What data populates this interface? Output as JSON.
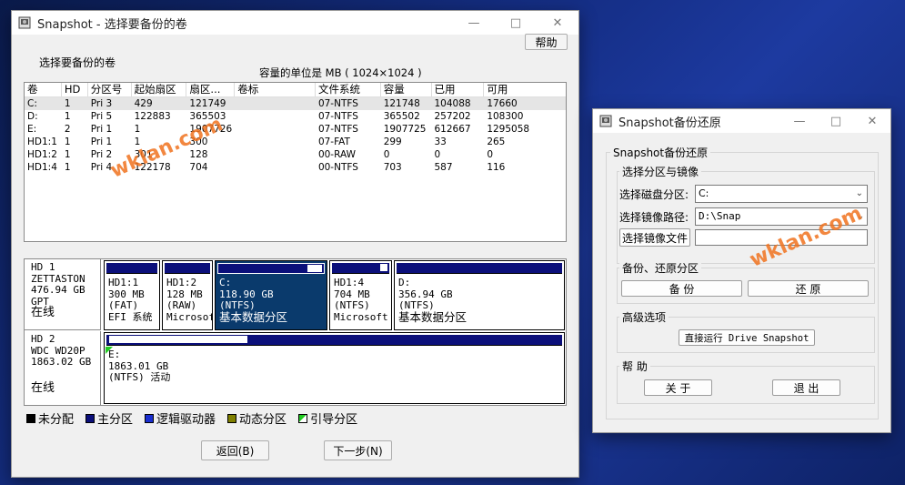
{
  "main_window": {
    "title": "Snapshot - 选择要备份的卷",
    "help_button": "帮助",
    "select_label": "选择要备份的卷",
    "unit_note": "容量的单位是 MB ( 1024×1024 )",
    "columns": [
      "卷",
      "HD",
      "分区号",
      "起始扇区",
      "扇区...",
      "卷标",
      "文件系统",
      "容量",
      "已用",
      "可用"
    ],
    "rows": [
      [
        "C:",
        "1",
        "Pri",
        "3",
        "429",
        "121749",
        "",
        "07-NTFS",
        "121748",
        "104088",
        "17660"
      ],
      [
        "D:",
        "1",
        "Pri",
        "5",
        "122883",
        "365503",
        "",
        "07-NTFS",
        "365502",
        "257202",
        "108300"
      ],
      [
        "E:",
        "2",
        "Pri",
        "1",
        "1",
        "1907726",
        "",
        "07-NTFS",
        "1907725",
        "612667",
        "1295058"
      ],
      [
        "HD1:1",
        "1",
        "Pri",
        "1",
        "1",
        "300",
        "",
        "07-FAT",
        "299",
        "33",
        "265"
      ],
      [
        "HD1:2",
        "1",
        "Pri",
        "2",
        "301",
        "128",
        "",
        "00-RAW",
        "0",
        "0",
        "0"
      ],
      [
        "HD1:4",
        "1",
        "Pri",
        "4",
        "122178",
        "704",
        "",
        "00-NTFS",
        "703",
        "587",
        "116"
      ]
    ],
    "disk1": {
      "label_lines": [
        "HD 1",
        " ZETTASTON",
        "476.94 GB",
        "GPT",
        "在线"
      ],
      "partitions": [
        {
          "lines": [
            "HD1:1",
            "300 MB",
            "(FAT)",
            "EFI 系统"
          ]
        },
        {
          "lines": [
            "HD1:2",
            "128 MB",
            "(RAW)",
            "Microsof"
          ]
        },
        {
          "lines": [
            "C:",
            "118.90 GB",
            "(NTFS)",
            "基本数据分区"
          ]
        },
        {
          "lines": [
            "HD1:4",
            "704 MB",
            "(NTFS)",
            "Microsoft"
          ]
        },
        {
          "lines": [
            "D:",
            "356.94 GB",
            "(NTFS)",
            "基本数据分区"
          ]
        }
      ]
    },
    "disk2": {
      "label_lines": [
        "HD 2",
        " WDC WD20P",
        "1863.02 GB",
        "",
        "在线"
      ],
      "partition_lines": [
        "E:",
        "1863.01 GB",
        "(NTFS) 活动"
      ]
    },
    "legend": [
      "未分配",
      "主分区",
      "逻辑驱动器",
      "动态分区",
      "引导分区"
    ],
    "legend_colors": [
      "#000000",
      "#0b0f7a",
      "#1a2fd0",
      "#808000",
      "#22cc22"
    ],
    "back_button": "返回(B)",
    "next_button": "下一步(N)"
  },
  "restore_window": {
    "title": "Snapshot备份还原",
    "outer_group": "Snapshot备份还原",
    "select_group": "选择分区与镜像",
    "disk_label": "选择磁盘分区:",
    "disk_value": "C:",
    "path_label": "选择镜像路径:",
    "path_value": "D:\\Snap",
    "file_button": "选择镜像文件",
    "file_value": "",
    "backup_group": "备份、还原分区",
    "backup_button": "备 份",
    "restore_button": "还 原",
    "advanced_group": "高级选项",
    "run_button": "直接运行 Drive Snapshot",
    "help_group": "帮 助",
    "about_button": "关 于",
    "exit_button": "退 出"
  },
  "watermark": "wklan.com"
}
